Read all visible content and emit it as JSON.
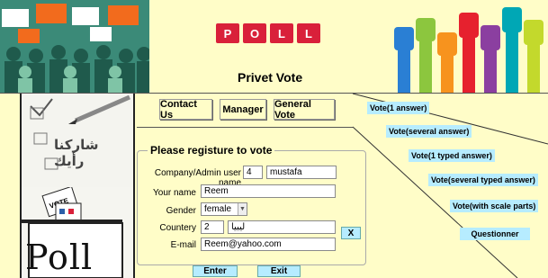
{
  "header": {
    "logo_text": "POLL",
    "title": "Privet Vote"
  },
  "left_panel": {
    "arabic_text": "شاركنا رأيك",
    "ballot_word": "Poll",
    "ballot_sign": "VOTE"
  },
  "nav": {
    "contact": "Contact Us",
    "manager": "Manager",
    "general_vote": "General Vote"
  },
  "form": {
    "legend": "Please registure to vote",
    "company_label": "Company/Admin user name",
    "company_id": "4",
    "company_name": "mustafa",
    "name_label": "Your name",
    "name_value": "Reem",
    "gender_label": "Gender",
    "gender_value": "female",
    "country_label": "Countery",
    "country_id": "2",
    "country_name": "ليبيا",
    "email_label": "E-mail",
    "email_value": "Reem@yahoo.com",
    "x_button": "X",
    "enter": "Enter",
    "exit": "Exit"
  },
  "vote_links": [
    "Vote(1 answer)",
    "Vote(several answer)",
    "Vote(1 typed answer)",
    "Vote(several typed answer)",
    "Vote(with scale parts)",
    "Questionner"
  ],
  "colors": {
    "background": "#fffdc8",
    "accent": "#b6ecff"
  }
}
